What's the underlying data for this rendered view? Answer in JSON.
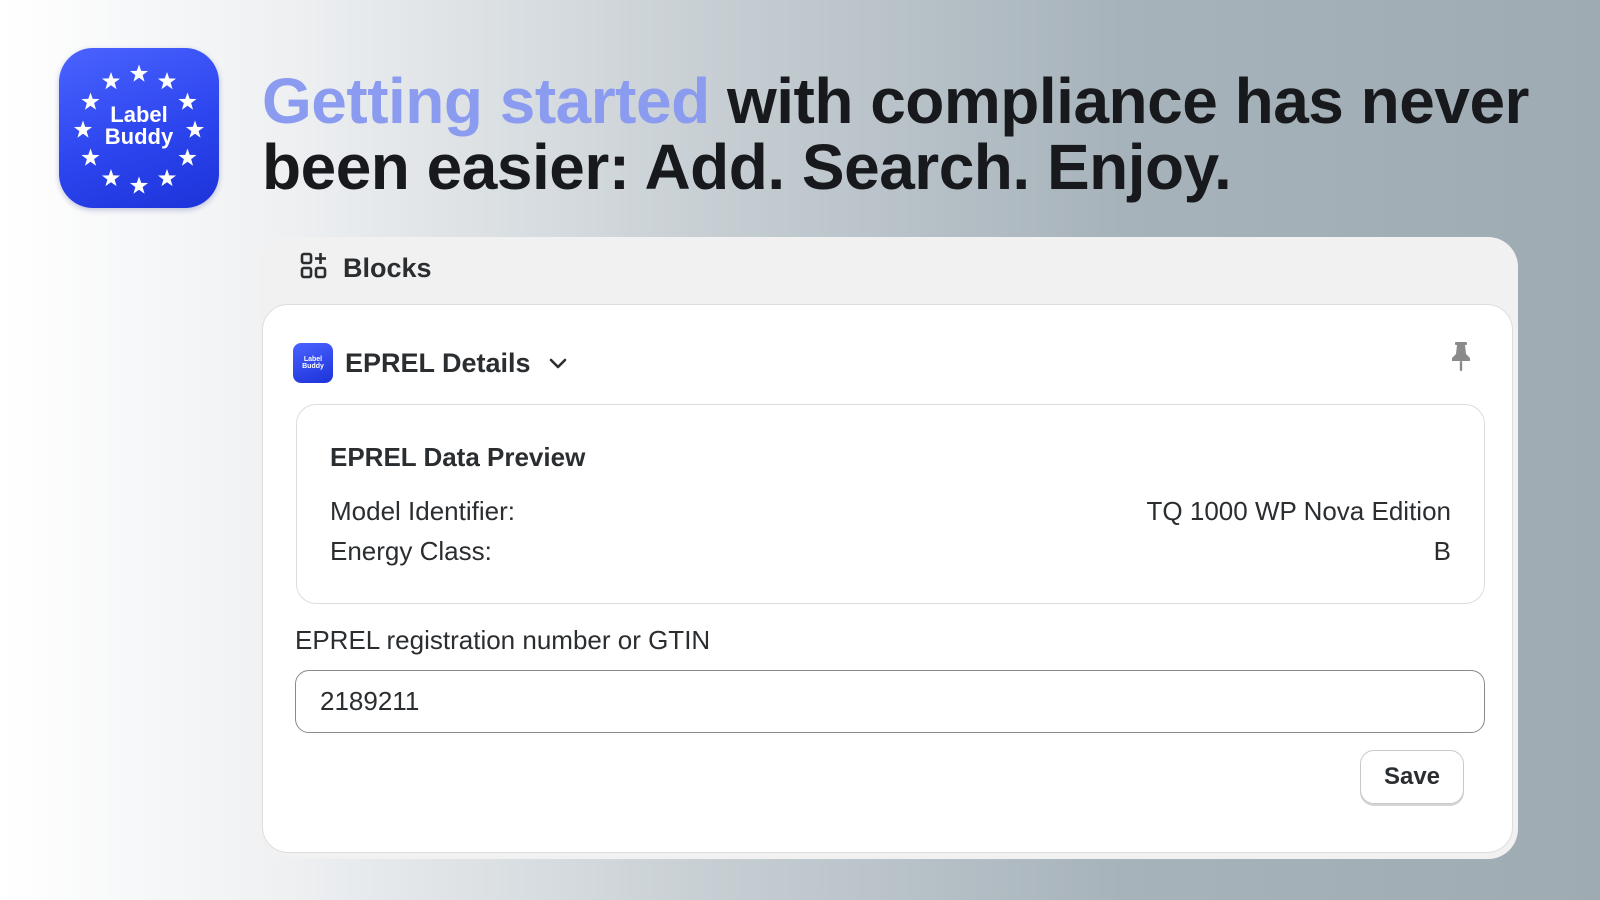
{
  "logo": {
    "line1": "Label",
    "line2": "Buddy"
  },
  "headline": {
    "accent": "Getting started",
    "rest": " with compliance has never been easier: Add. Search. Enjoy."
  },
  "panel": {
    "header_label": "Blocks",
    "card": {
      "title": "EPREL Details",
      "preview": {
        "title": "EPREL Data Preview",
        "rows": [
          {
            "label": "Model Identifier:",
            "value": "TQ 1000 WP Nova Edition"
          },
          {
            "label": "Energy Class:",
            "value": "B"
          }
        ]
      },
      "field": {
        "label": "EPREL registration number or GTIN",
        "value": "2189211"
      },
      "save_label": "Save"
    }
  },
  "colors": {
    "accent_text": "#8b9bf0",
    "logo_blue": "#2d45ee"
  }
}
